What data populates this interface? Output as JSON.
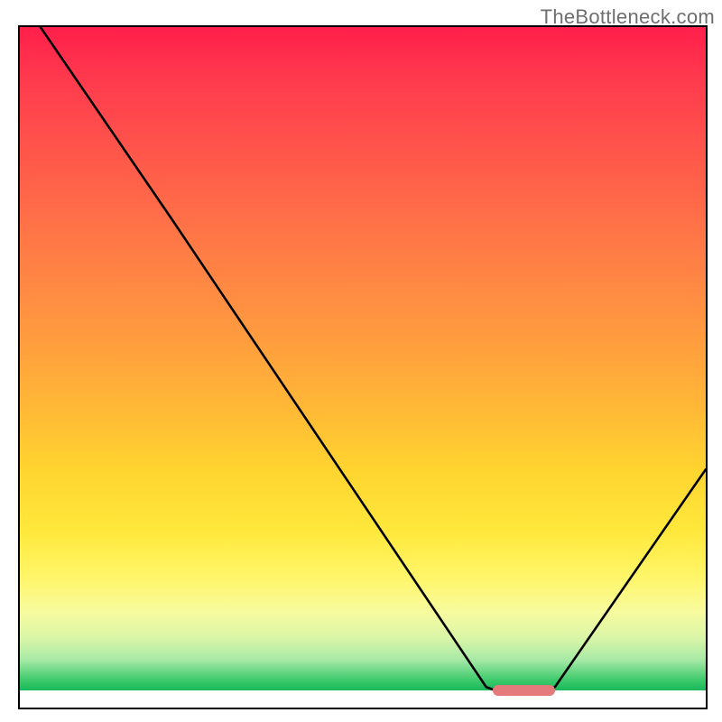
{
  "watermark": "TheBottleneck.com",
  "chart_data": {
    "type": "line",
    "title": "",
    "xlabel": "",
    "ylabel": "",
    "xlim": [
      0,
      100
    ],
    "ylim": [
      0,
      100
    ],
    "grid": false,
    "curve": [
      {
        "x": 3,
        "y": 100
      },
      {
        "x": 22,
        "y": 72
      },
      {
        "x": 68,
        "y": 3
      },
      {
        "x": 70,
        "y": 2.3
      },
      {
        "x": 76,
        "y": 2.3
      },
      {
        "x": 78,
        "y": 3
      },
      {
        "x": 100,
        "y": 35
      }
    ],
    "marker": {
      "x_start": 69,
      "x_end": 78,
      "y": 2.5
    },
    "gradient_stops": [
      {
        "pos": 0,
        "color": "#ff1f4b"
      },
      {
        "pos": 50,
        "color": "#ffa53c"
      },
      {
        "pos": 78,
        "color": "#fff050"
      },
      {
        "pos": 96,
        "color": "#1fbb55"
      },
      {
        "pos": 100,
        "color": "#ffffff"
      }
    ]
  },
  "frame": {
    "inner_w": 760,
    "inner_h": 754
  }
}
